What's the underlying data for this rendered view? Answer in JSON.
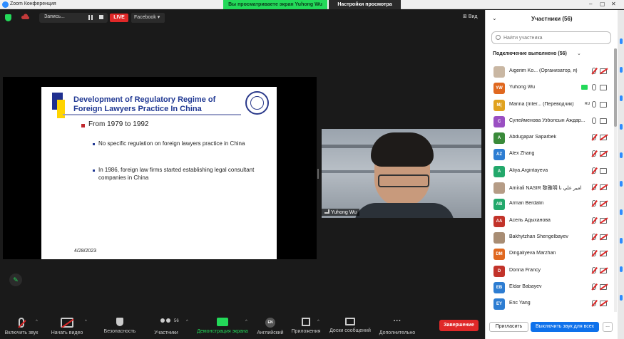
{
  "window": {
    "title": "Zoom Конференция",
    "share_banner": "Вы просматриваете экран Yuhong Wu",
    "view_settings": "Настройки просмотра"
  },
  "topbar": {
    "recording_label": "Запись...",
    "live_label": "LIVE",
    "stream_target": "Facebook",
    "view_label": "Вид"
  },
  "slide": {
    "title": "Development of Regulatory Regime of Foreign Lawyers Practice In China",
    "heading": "From 1979 to 1992",
    "bullet1": "No specific regulation on foreign lawyers practice in China",
    "bullet2": "In 1986, foreign law firms started establishing legal consultant companies in China",
    "date": "4/28/2023"
  },
  "video": {
    "name": "Yuhong Wu"
  },
  "toolbar": {
    "unmute": "Включить звук",
    "start_video": "Начать видео",
    "security": "Безопасность",
    "participants": "Участники",
    "participants_count": "56",
    "share": "Демонстрация экрана",
    "language": "Английский",
    "language_code": "EN",
    "apps": "Приложения",
    "whiteboards": "Доски сообщений",
    "more": "Дополнительно",
    "end": "Завершение"
  },
  "panel": {
    "header": "Участники (56)",
    "search_placeholder": "Найти участника",
    "connected": "Подключение выполнено (56)",
    "invite": "Пригласить",
    "unmute_all": "Выключить звук для всех",
    "more": "..."
  },
  "participants": [
    {
      "initials": "",
      "name": "Aigerim Ko... (Организатор, я)",
      "color": "#c9b7a3",
      "mic": "muted",
      "cam": "off"
    },
    {
      "initials": "YW",
      "name": "Yuhong Wu",
      "color": "#e0681f",
      "mic": "on",
      "cam": "on"
    },
    {
      "initials": "M(",
      "name": "Marina (Inter... (Переводчик)",
      "color": "#e0a21f",
      "mic": "on",
      "cam": "on",
      "badge": "RU"
    },
    {
      "initials": "С",
      "name": "Сулейменова Узболсын Аждар...",
      "color": "#9a4fc2",
      "mic": "on",
      "cam": "on"
    },
    {
      "initials": "A",
      "name": "Abdugapar Saparbek",
      "color": "#3a8a3a",
      "mic": "muted",
      "cam": "off"
    },
    {
      "initials": "AZ",
      "name": "Alex Zhang",
      "color": "#2d7dd2",
      "mic": "muted",
      "cam": "off"
    },
    {
      "initials": "A",
      "name": "Aliya.Argintayeva",
      "color": "#23a86b",
      "mic": "muted",
      "cam": "on"
    },
    {
      "initials": "",
      "name": "Amirali NASIR 黎雅明 امير علي نا",
      "color": "#b59c86",
      "mic": "muted",
      "cam": "off"
    },
    {
      "initials": "AB",
      "name": "Arman Berdalin",
      "color": "#23a86b",
      "mic": "muted",
      "cam": "off"
    },
    {
      "initials": "AA",
      "name": "Асель Адыханова",
      "color": "#c2332a",
      "mic": "muted",
      "cam": "off"
    },
    {
      "initials": "",
      "name": "Bakhytzhan Shengelbayev",
      "color": "#a88d74",
      "mic": "muted",
      "cam": "off"
    },
    {
      "initials": "DM",
      "name": "Dingaliyeva Marzhan",
      "color": "#e0681f",
      "mic": "muted",
      "cam": "off"
    },
    {
      "initials": "D",
      "name": "Donna Francy",
      "color": "#c2332a",
      "mic": "muted",
      "cam": "off"
    },
    {
      "initials": "EB",
      "name": "Eldar Babayev",
      "color": "#2d7dd2",
      "mic": "muted",
      "cam": "off"
    },
    {
      "initials": "EY",
      "name": "Eric Yang",
      "color": "#2d7dd2",
      "mic": "muted",
      "cam": "off"
    }
  ]
}
